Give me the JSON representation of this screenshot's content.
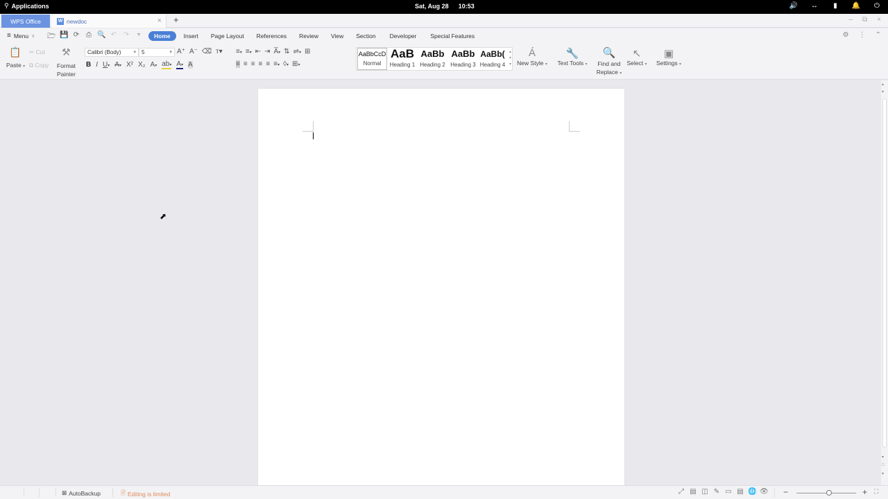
{
  "system_bar": {
    "applications_label": "Applications",
    "date": "Sat, Aug 28",
    "time": "10:53",
    "tray_icons": [
      "volume-icon",
      "network-icon",
      "battery-icon",
      "notification-bell-icon",
      "power-icon"
    ]
  },
  "tabs": {
    "app_tab": "WPS Office",
    "doc_tab": "newdoc",
    "doc_icon_letter": "W"
  },
  "menu": {
    "menu_label": "Menu",
    "ribbon_tabs": [
      "Home",
      "Insert",
      "Page Layout",
      "References",
      "Review",
      "View",
      "Section",
      "Developer",
      "Special Features"
    ],
    "active_tab": "Home"
  },
  "ribbon": {
    "paste": "Paste",
    "cut": "Cut",
    "copy": "Copy",
    "format_painter_1": "Format",
    "format_painter_2": "Painter",
    "font_name": "Calibri (Body)",
    "font_size": "5",
    "styles": [
      {
        "preview": "AaBbCcD",
        "label": "Normal"
      },
      {
        "preview": "AaB",
        "label": "Heading 1"
      },
      {
        "preview": "AaBb",
        "label": "Heading 2"
      },
      {
        "preview": "AaBb",
        "label": "Heading 3"
      },
      {
        "preview": "AaBb(",
        "label": "Heading 4"
      }
    ],
    "new_style": "New Style",
    "text_tools": "Text Tools",
    "find_replace_1": "Find and",
    "find_replace_2": "Replace",
    "select": "Select",
    "settings": "Settings"
  },
  "status_bar": {
    "autobackup": "AutoBackup",
    "editing_limited": "Editing is limited",
    "editing_color": "#e08a5a",
    "zoom_level_fraction": 0.55
  },
  "colors": {
    "accent": "#4a7fd6",
    "wps_tab": "#6b93e0"
  }
}
